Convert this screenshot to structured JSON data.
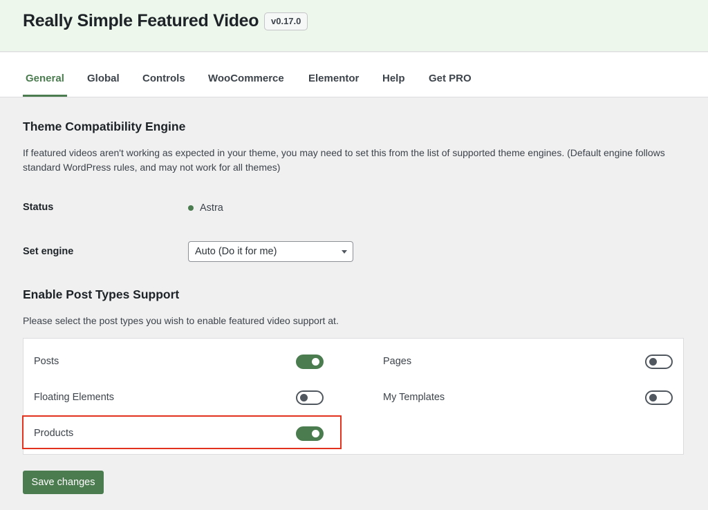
{
  "header": {
    "title": "Really Simple Featured Video",
    "version": "v0.17.0"
  },
  "tabs": [
    {
      "label": "General",
      "active": true
    },
    {
      "label": "Global",
      "active": false
    },
    {
      "label": "Controls",
      "active": false
    },
    {
      "label": "WooCommerce",
      "active": false
    },
    {
      "label": "Elementor",
      "active": false
    },
    {
      "label": "Help",
      "active": false
    },
    {
      "label": "Get PRO",
      "active": false
    }
  ],
  "theme_engine": {
    "heading": "Theme Compatibility Engine",
    "description": "If featured videos aren't working as expected in your theme, you may need to set this from the list of supported theme engines. (Default engine follows standard WordPress rules, and may not work for all themes)",
    "status_label": "Status",
    "status_value": "Astra",
    "status_color": "#4b7c4f",
    "set_engine_label": "Set engine",
    "set_engine_selected": "Auto (Do it for me)"
  },
  "post_types": {
    "heading": "Enable Post Types Support",
    "description": "Please select the post types you wish to enable featured video support at.",
    "items": [
      {
        "label": "Posts",
        "enabled": true
      },
      {
        "label": "Pages",
        "enabled": false
      },
      {
        "label": "Floating Elements",
        "enabled": false
      },
      {
        "label": "My Templates",
        "enabled": false
      },
      {
        "label": "Products",
        "enabled": true
      }
    ]
  },
  "save_label": "Save changes",
  "colors": {
    "accent": "#4b7c4f",
    "highlight": "#e2311d",
    "header_bg": "#eef7ec"
  }
}
